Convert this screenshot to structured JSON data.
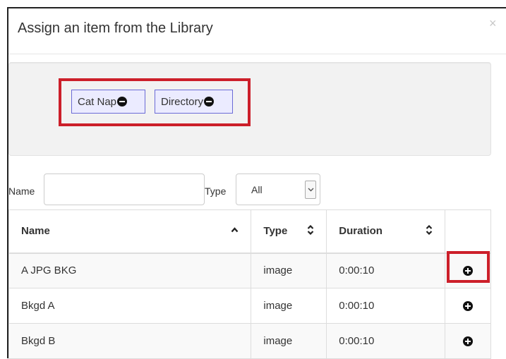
{
  "modal": {
    "title": "Assign an item from the Library",
    "close_label": "×"
  },
  "assigned": {
    "tags": [
      {
        "label": "Cat Nap"
      },
      {
        "label": "Directory"
      }
    ]
  },
  "filters": {
    "name_label": "Name",
    "name_value": "",
    "type_label": "Type",
    "type_value": "All"
  },
  "table": {
    "headers": {
      "name": "Name",
      "type": "Type",
      "duration": "Duration"
    },
    "sort": {
      "name": "ascending",
      "type": "unsorted",
      "duration": "unsorted"
    },
    "rows": [
      {
        "name": "A JPG BKG",
        "type": "image",
        "duration": "0:00:10"
      },
      {
        "name": "Bkgd A",
        "type": "image",
        "duration": "0:00:10"
      },
      {
        "name": "Bkgd B",
        "type": "image",
        "duration": "0:00:10"
      }
    ]
  },
  "icons": {
    "remove_tag": "minus-circle-icon",
    "add_item": "plus-circle-icon",
    "sort_asc": "caret-up-icon",
    "sort_both": "sort-icon",
    "dropdown": "chevron-down-icon"
  },
  "colors": {
    "highlight": "#cc1f2a",
    "tag_border": "#6b6bd6",
    "tag_background": "#ebebff"
  }
}
